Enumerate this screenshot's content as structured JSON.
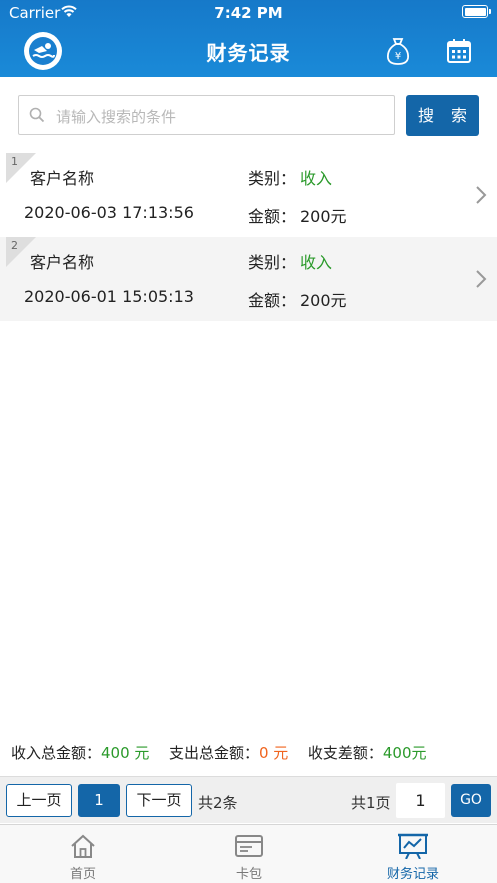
{
  "status_bar": {
    "carrier": "Carrier",
    "time": "7:42 PM"
  },
  "header": {
    "title": "财务记录",
    "left_icon": "swimmer-logo-icon",
    "right_icons": [
      "money-bag-icon",
      "calendar-icon"
    ]
  },
  "search": {
    "placeholder": "请输入搜索的条件",
    "button_label": "搜 索"
  },
  "records": [
    {
      "index": "1",
      "name": "客户名称",
      "datetime": "2020-06-03 17:13:56",
      "type_label": "类别：",
      "type_value": "收入",
      "amount_label": "金额：",
      "amount_value": "200元"
    },
    {
      "index": "2",
      "name": "客户名称",
      "datetime": "2020-06-01 15:05:13",
      "type_label": "类别：",
      "type_value": "收入",
      "amount_label": "金额：",
      "amount_value": "200元"
    }
  ],
  "totals": {
    "income_label": "收入总金额：",
    "income_value": "400 元",
    "expense_label": "支出总金额：",
    "expense_value": "0 元",
    "diff_label": "收支差额：",
    "diff_value": "400元"
  },
  "pager": {
    "prev_label": "上一页",
    "current_page": "1",
    "next_label": "下一页",
    "total_items": "共2条",
    "total_pages": "共1页",
    "goto_value": "1",
    "go_label": "GO"
  },
  "tabbar": [
    {
      "label": "首页",
      "icon": "home-icon",
      "active": false
    },
    {
      "label": "卡包",
      "icon": "card-wallet-icon",
      "active": false
    },
    {
      "label": "财务记录",
      "icon": "finance-chart-icon",
      "active": true
    }
  ],
  "colors": {
    "brand_blue": "#1466a8",
    "header_blue": "#1a85d4",
    "income_green": "#2b9a2b",
    "expense_orange": "#f0641e"
  }
}
